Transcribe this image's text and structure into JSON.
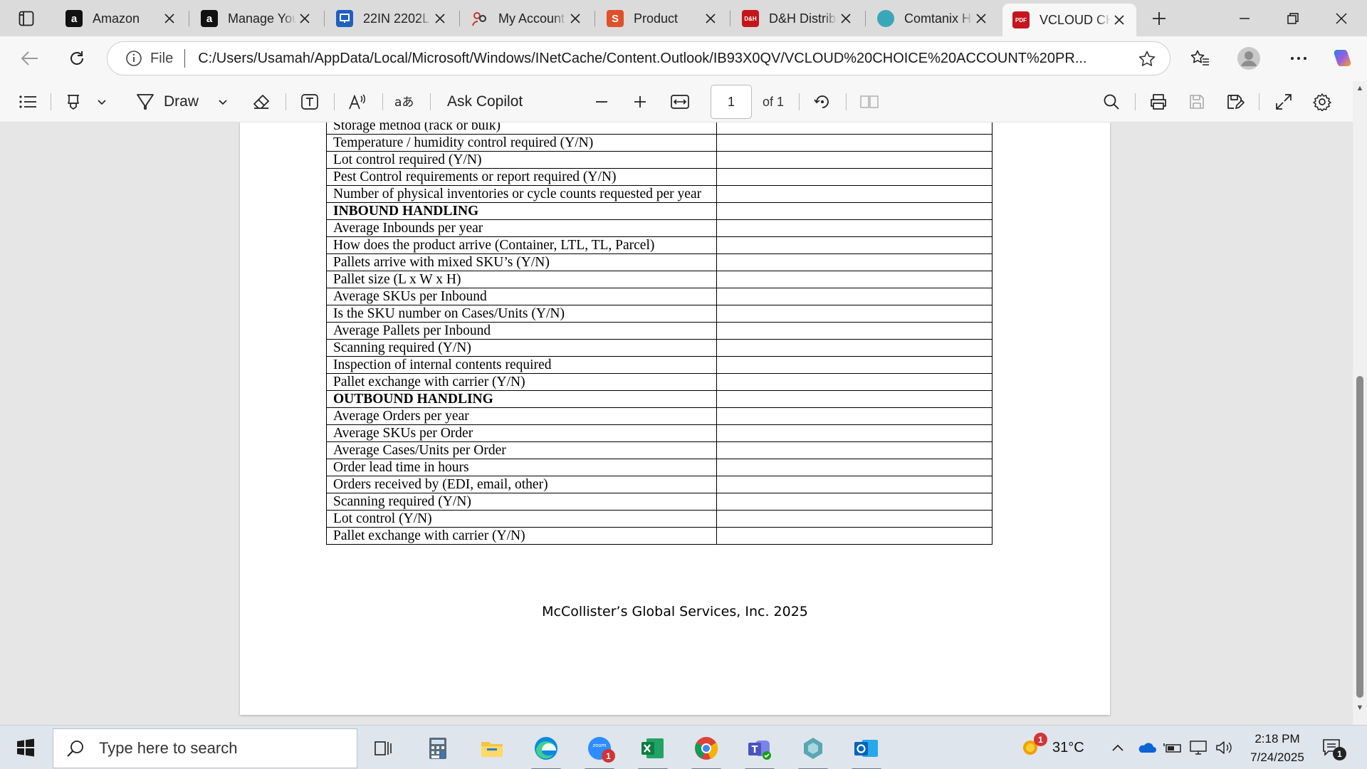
{
  "browser": {
    "tabs": [
      {
        "title": "Amazon",
        "icon": "amazon-icon",
        "fav": "a",
        "color": "#111111"
      },
      {
        "title": "Manage Your",
        "icon": "amazon-icon",
        "fav": "a",
        "color": "#111111"
      },
      {
        "title": "22IN 2202L",
        "icon": "monitor-brand-icon",
        "fav": "",
        "color": "#1f5fbf"
      },
      {
        "title": "My Account",
        "icon": "account-people-icon",
        "fav": "",
        "color": "#c0392b"
      },
      {
        "title": "Product",
        "icon": "product-s-icon",
        "fav": "S",
        "color": "#e0502a"
      },
      {
        "title": "D&H Distrib",
        "icon": "dh-icon",
        "fav": "D&H",
        "color": "#c4161c"
      },
      {
        "title": "Comtanix Hi",
        "icon": "comtanix-icon",
        "fav": "",
        "color": "#3aa7b8"
      },
      {
        "title": "VCLOUD CH",
        "icon": "pdf-icon",
        "fav": "PDF",
        "color": "#c4161c",
        "active": true
      }
    ],
    "address": {
      "scheme": "File",
      "url": "C:/Users/Usamah/AppData/Local/Microsoft/Windows/INetCache/Content.Outlook/IB93X0QV/VCLOUD%20CHOICE%20ACCOUNT%20PR..."
    }
  },
  "pdf_toolbar": {
    "draw_label": "Draw",
    "copilot_label": "Ask Copilot",
    "page_number": "1",
    "page_of": "of 1"
  },
  "document": {
    "rows": [
      {
        "q": "Storage method (rack or bulk)",
        "section": false
      },
      {
        "q": "Temperature / humidity control required (Y/N)",
        "section": false
      },
      {
        "q": "Lot control required (Y/N)",
        "section": false
      },
      {
        "q": "Pest Control requirements or report required (Y/N)",
        "section": false
      },
      {
        "q": "Number of physical inventories or cycle counts requested per year",
        "section": false
      },
      {
        "q": "INBOUND HANDLING",
        "section": true
      },
      {
        "q": "Average Inbounds per year",
        "section": false
      },
      {
        "q": "How does the product arrive (Container, LTL, TL, Parcel)",
        "section": false
      },
      {
        "q": "Pallets arrive with mixed SKU’s (Y/N)",
        "section": false
      },
      {
        "q": "Pallet size (L x W x H)",
        "section": false
      },
      {
        "q": "Average SKUs per Inbound",
        "section": false
      },
      {
        "q": "Is the SKU number on Cases/Units (Y/N)",
        "section": false
      },
      {
        "q": "Average Pallets per Inbound",
        "section": false
      },
      {
        "q": "Scanning required (Y/N)",
        "section": false
      },
      {
        "q": "Inspection of internal contents required",
        "section": false
      },
      {
        "q": "Pallet exchange with carrier (Y/N)",
        "section": false
      },
      {
        "q": "OUTBOUND HANDLING",
        "section": true
      },
      {
        "q": "Average Orders per year",
        "section": false
      },
      {
        "q": "Average SKUs per Order",
        "section": false
      },
      {
        "q": "Average Cases/Units per Order",
        "section": false
      },
      {
        "q": "Order lead time in hours",
        "section": false
      },
      {
        "q": "Orders received by (EDI, email, other)",
        "section": false
      },
      {
        "q": "Scanning required (Y/N)",
        "section": false
      },
      {
        "q": "Lot control (Y/N)",
        "section": false
      },
      {
        "q": "Pallet exchange with carrier (Y/N)",
        "section": false
      }
    ],
    "footer": "McCollister’s Global Services, Inc. 2025"
  },
  "taskbar": {
    "search_placeholder": "Type here to search",
    "apps": [
      {
        "name": "task-view-icon"
      },
      {
        "name": "calculator-icon"
      },
      {
        "name": "file-explorer-icon"
      },
      {
        "name": "edge-icon",
        "active": true
      },
      {
        "name": "zoom-icon",
        "badge": "1",
        "active": true
      },
      {
        "name": "excel-icon",
        "active": true
      },
      {
        "name": "chrome-icon",
        "active": true
      },
      {
        "name": "teams-icon",
        "active": true
      },
      {
        "name": "comtanix-app-icon",
        "active": true
      },
      {
        "name": "outlook-icon",
        "active": true
      }
    ],
    "weather": {
      "temp": "31°C",
      "badge": "1"
    },
    "clock": {
      "time": "2:18 PM",
      "date": "7/24/2025"
    },
    "notification_badge": "1"
  }
}
